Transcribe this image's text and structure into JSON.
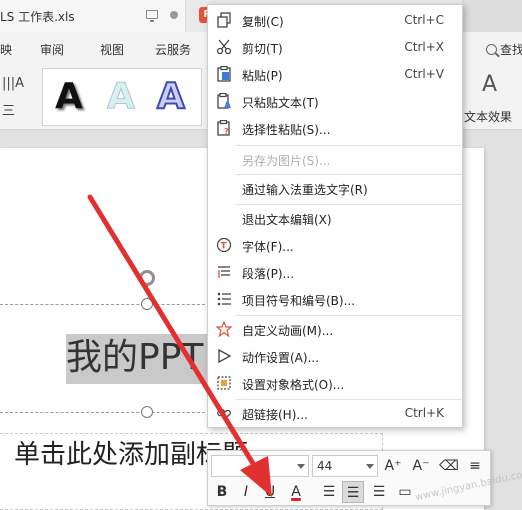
{
  "titlebar": {
    "doc_tab_label": "LS 工作表.xls",
    "ppt_tab_icon": "P"
  },
  "menu": {
    "items": [
      "映",
      "审阅",
      "视图",
      "云服务"
    ],
    "search_label": "查找"
  },
  "ribbon": {
    "small_left_top": "|||A",
    "small_left_bottom": "三",
    "wordart_glyph": "A",
    "text_effect_label": "文本效果"
  },
  "slide": {
    "title": "我的PPT",
    "subtitle": "单击此处添加副标题"
  },
  "context_menu": {
    "items": [
      {
        "label": "复制(C)",
        "shortcut": "Ctrl+C",
        "icon": "copy-icon"
      },
      {
        "label": "剪切(T)",
        "shortcut": "Ctrl+X",
        "icon": "scissors-icon"
      },
      {
        "label": "粘贴(P)",
        "shortcut": "Ctrl+V",
        "icon": "paste-icon"
      },
      {
        "label": "只粘贴文本(T)",
        "shortcut": "",
        "icon": "paste-text-icon"
      },
      {
        "label": "选择性粘贴(S)...",
        "shortcut": "",
        "icon": "paste-special-icon"
      },
      {
        "label": "另存为图片(S)...",
        "shortcut": "",
        "icon": "",
        "disabled": true
      },
      {
        "label": "通过输入法重选文字(R)",
        "shortcut": "",
        "icon": ""
      },
      {
        "label": "退出文本编辑(X)",
        "shortcut": "",
        "icon": ""
      },
      {
        "label": "字体(F)...",
        "shortcut": "",
        "icon": "font-icon"
      },
      {
        "label": "段落(P)...",
        "shortcut": "",
        "icon": "paragraph-icon"
      },
      {
        "label": "项目符号和编号(B)...",
        "shortcut": "",
        "icon": "bullets-icon"
      },
      {
        "label": "自定义动画(M)...",
        "shortcut": "",
        "icon": "star-icon"
      },
      {
        "label": "动作设置(A)...",
        "shortcut": "",
        "icon": "play-icon"
      },
      {
        "label": "设置对象格式(O)...",
        "shortcut": "",
        "icon": "format-icon"
      },
      {
        "label": "超链接(H)...",
        "shortcut": "Ctrl+K",
        "icon": "link-icon"
      }
    ]
  },
  "mini_toolbar": {
    "font_name": "",
    "font_size": "44",
    "grow_font": "A⁺",
    "shrink_font": "A⁻",
    "bold": "B",
    "italic": "I",
    "underline": "U",
    "font_color": "A"
  },
  "watermark": "www.jingyan.baidu.com",
  "colors": {
    "arrow": "#e23030",
    "accent": "#e8523b"
  }
}
